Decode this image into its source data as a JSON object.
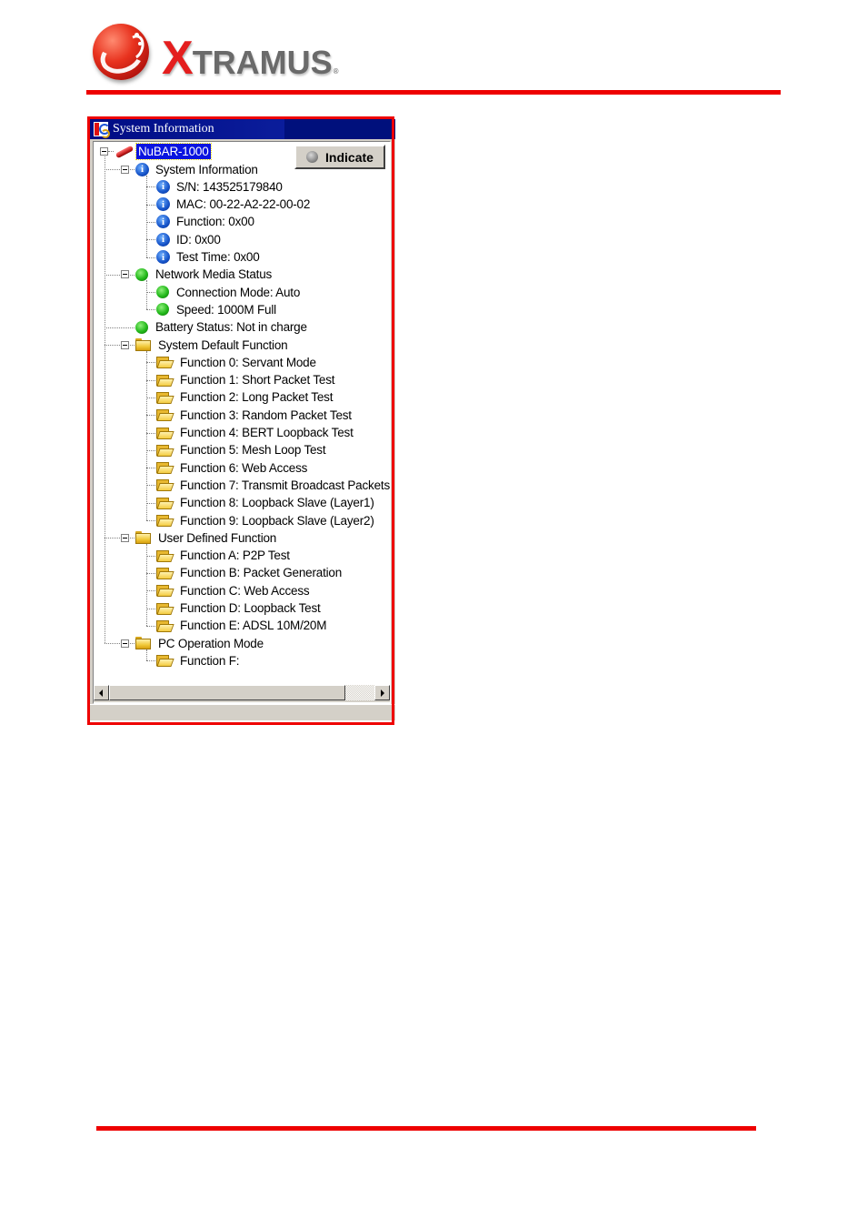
{
  "header": {
    "logo_first_letter": "X",
    "logo_rest": "TRAMUS",
    "logo_registered": "®",
    "brand_color": "#ee0000"
  },
  "window": {
    "title": "System Information",
    "indicate_button": "Indicate",
    "root": {
      "label": "NuBAR-1000",
      "icon": "device-icon",
      "selected": true
    },
    "tree": [
      {
        "level": 1,
        "icon": "info-icon",
        "label": "System Information",
        "expanded": true
      },
      {
        "level": 2,
        "icon": "info-icon",
        "label": "S/N: 143525179840"
      },
      {
        "level": 2,
        "icon": "info-icon",
        "label": "MAC: 00-22-A2-22-00-02"
      },
      {
        "level": 2,
        "icon": "info-icon",
        "label": "Function: 0x00"
      },
      {
        "level": 2,
        "icon": "info-icon",
        "label": "ID: 0x00"
      },
      {
        "level": 2,
        "icon": "info-icon",
        "label": "Test Time: 0x00"
      },
      {
        "level": 1,
        "icon": "green-status-icon",
        "label": "Network Media Status",
        "expanded": true
      },
      {
        "level": 2,
        "icon": "green-status-icon",
        "label": "Connection Mode: Auto"
      },
      {
        "level": 2,
        "icon": "green-status-icon",
        "label": "Speed: 1000M Full"
      },
      {
        "level": 1,
        "icon": "green-status-icon",
        "label": "Battery Status: Not in charge"
      },
      {
        "level": 1,
        "icon": "folder-closed-icon",
        "label": "System Default Function",
        "expanded": true
      },
      {
        "level": 2,
        "icon": "folder-open-icon",
        "label": "Function 0: Servant Mode"
      },
      {
        "level": 2,
        "icon": "folder-open-icon",
        "label": "Function 1: Short Packet Test"
      },
      {
        "level": 2,
        "icon": "folder-open-icon",
        "label": "Function 2: Long Packet Test"
      },
      {
        "level": 2,
        "icon": "folder-open-icon",
        "label": "Function 3: Random Packet Test"
      },
      {
        "level": 2,
        "icon": "folder-open-icon",
        "label": "Function 4: BERT Loopback Test"
      },
      {
        "level": 2,
        "icon": "folder-open-icon",
        "label": "Function 5: Mesh Loop Test"
      },
      {
        "level": 2,
        "icon": "folder-open-icon",
        "label": "Function 6: Web Access"
      },
      {
        "level": 2,
        "icon": "folder-open-icon",
        "label": "Function 7: Transmit Broadcast Packets"
      },
      {
        "level": 2,
        "icon": "folder-open-icon",
        "label": "Function 8: Loopback Slave (Layer1)"
      },
      {
        "level": 2,
        "icon": "folder-open-icon",
        "label": "Function 9: Loopback Slave (Layer2)"
      },
      {
        "level": 1,
        "icon": "folder-closed-icon",
        "label": "User Defined Function",
        "expanded": true
      },
      {
        "level": 2,
        "icon": "folder-open-icon",
        "label": "Function A: P2P Test"
      },
      {
        "level": 2,
        "icon": "folder-open-icon",
        "label": "Function B: Packet Generation"
      },
      {
        "level": 2,
        "icon": "folder-open-icon",
        "label": "Function C: Web Access"
      },
      {
        "level": 2,
        "icon": "folder-open-icon",
        "label": "Function D: Loopback Test"
      },
      {
        "level": 2,
        "icon": "folder-open-icon",
        "label": "Function E: ADSL 10M/20M"
      },
      {
        "level": 1,
        "icon": "folder-closed-icon",
        "label": "PC Operation Mode",
        "expanded": true
      },
      {
        "level": 2,
        "icon": "folder-open-icon",
        "label": "Function F:"
      }
    ]
  }
}
